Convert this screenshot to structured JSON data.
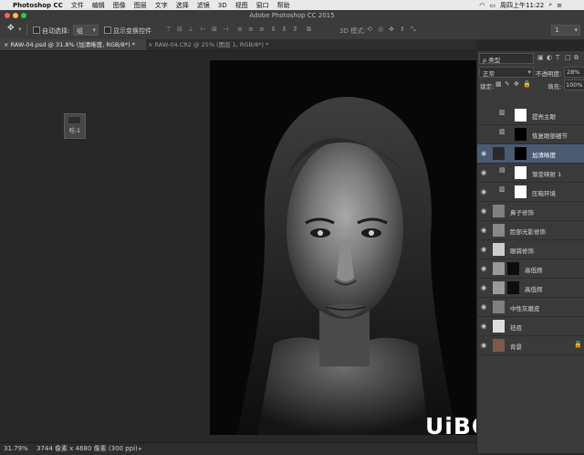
{
  "menubar": {
    "app": "Photoshop CC",
    "items": [
      "文件",
      "编辑",
      "图像",
      "图层",
      "文字",
      "选择",
      "滤镜",
      "3D",
      "视图",
      "窗口",
      "帮助"
    ],
    "clock": "周四上午11:22"
  },
  "window_title": "Adobe Photoshop CC 2015",
  "options_bar": {
    "auto_select_label": "自动选择:",
    "auto_select_value": "组",
    "transform_label": "显示变换控件",
    "mode_3d_label": "3D 模式:",
    "workspace_value": "1"
  },
  "tabs": [
    {
      "label": "RAW-04.psd @ 31.8% (加清晰度, RGB/8*) *",
      "active": true
    },
    {
      "label": "RAW-04.CR2 @ 25% (图层 1, RGB/8*) *",
      "active": false
    }
  ],
  "mini_doc_label": "吃-1",
  "layers_panel": {
    "filter_value": "ρ 类型",
    "blend_mode": "正常",
    "opacity_label": "不透明度:",
    "opacity_value": "28%",
    "lock_label": "锁定:",
    "fill_label": "填充:",
    "fill_value": "100%",
    "layers": [
      {
        "name": "提亮主眼",
        "visible": false,
        "selected": false
      },
      {
        "name": "恢复眼部细节",
        "visible": false,
        "selected": false
      },
      {
        "name": "加清晰度",
        "visible": true,
        "selected": true
      },
      {
        "name": "渐变映射 1",
        "visible": true,
        "selected": false
      },
      {
        "name": "压暗环境",
        "visible": true,
        "selected": false
      },
      {
        "name": "鼻子修饰",
        "visible": true,
        "selected": false
      },
      {
        "name": "脸部光影修饰",
        "visible": true,
        "selected": false
      },
      {
        "name": "眼袋修饰",
        "visible": true,
        "selected": false
      },
      {
        "name": "高低频",
        "visible": true,
        "selected": false
      },
      {
        "name": "高低频",
        "visible": true,
        "selected": false
      },
      {
        "name": "中性灰磨皮",
        "visible": true,
        "selected": false
      },
      {
        "name": "祛痘",
        "visible": true,
        "selected": false
      },
      {
        "name": "背景",
        "visible": true,
        "selected": false
      }
    ]
  },
  "status_bar": {
    "zoom": "31.79%",
    "doc_info": "3744 像素 x 4680 像素 (300 ppi)"
  },
  "watermark": "UiBQ.CoM",
  "icons": {
    "apple": "apple-logo-icon",
    "move": "move-tool-icon",
    "eye": "eye-icon",
    "lock": "lock-icon"
  }
}
